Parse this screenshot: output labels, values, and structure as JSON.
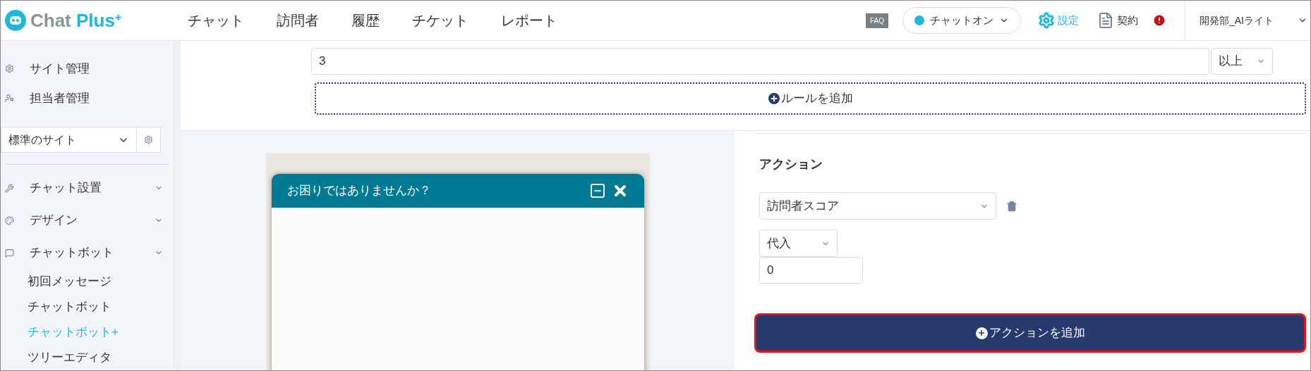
{
  "header": {
    "logo": {
      "word1": "Chat",
      "word2": "Plus",
      "mark": "+"
    },
    "nav": [
      {
        "label": "チャット"
      },
      {
        "label": "訪問者"
      },
      {
        "label": "履歴"
      },
      {
        "label": "チケット"
      },
      {
        "label": "レポート"
      }
    ],
    "faq": "FAQ",
    "chat_status": {
      "label": "チャットオン",
      "on": true
    },
    "settings": "設定",
    "contract": "契約",
    "user": "開発部_AIライト"
  },
  "sidebar": {
    "top_links": [
      {
        "label": "サイト管理"
      },
      {
        "label": "担当者管理"
      }
    ],
    "site_select": {
      "value": "標準のサイト"
    },
    "menu": [
      {
        "label": "チャット設置"
      },
      {
        "label": "デザイン"
      },
      {
        "label": "チャットボット",
        "children": [
          {
            "label": "初回メッセージ",
            "selected": false
          },
          {
            "label": "チャットボット",
            "selected": false
          },
          {
            "label": "チャットボット+",
            "selected": true
          },
          {
            "label": "ツリーエディタ",
            "selected": false
          }
        ]
      }
    ]
  },
  "rule": {
    "value": "3",
    "operator": "以上",
    "add_rule": "ルールを追加"
  },
  "preview": {
    "title": "お困りではありませんか？"
  },
  "action": {
    "heading": "アクション",
    "target": "訪問者スコア",
    "mode": "代入",
    "value": "0",
    "add_action": "アクションを追加"
  }
}
